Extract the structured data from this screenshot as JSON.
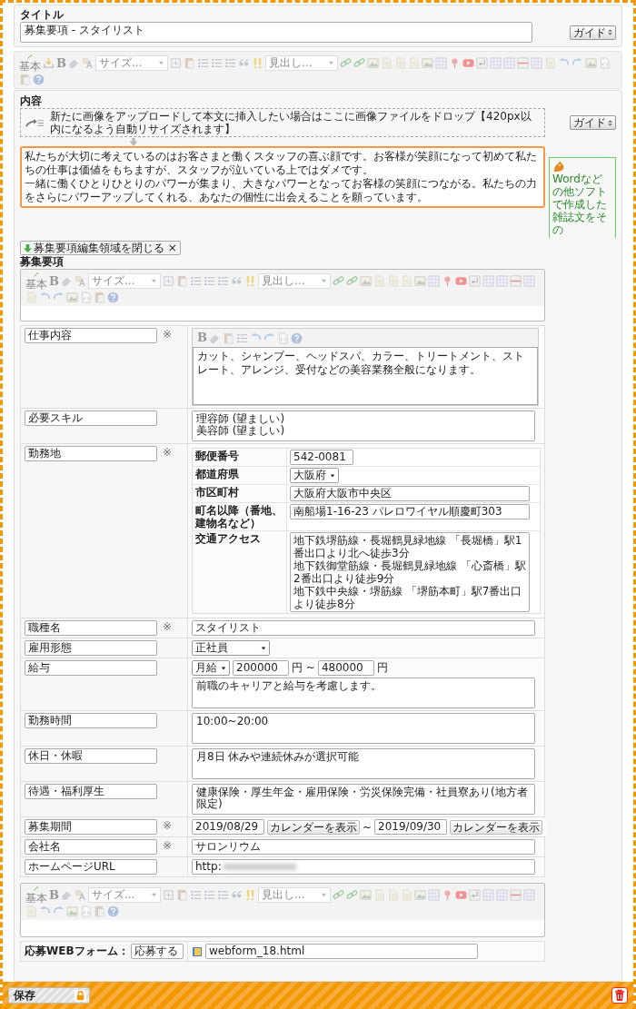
{
  "title_section": {
    "label": "タイトル",
    "value": "募集要項 - スタイリスト",
    "guide": "ガイド"
  },
  "main_toolbar": [
    {
      "kind": "basic",
      "label": "基本"
    },
    {
      "kind": "import"
    },
    {
      "kind": "bold",
      "label": "B"
    },
    {
      "kind": "eraser"
    },
    {
      "kind": "fontcolor"
    },
    {
      "kind": "select",
      "label": "サイズ..."
    },
    {
      "kind": "plus"
    },
    {
      "kind": "paste"
    },
    {
      "kind": "list"
    },
    {
      "kind": "list"
    },
    {
      "kind": "list"
    },
    {
      "kind": "quote"
    },
    {
      "kind": "exclaim"
    },
    {
      "kind": "select",
      "label": "見出し..."
    },
    {
      "kind": "link"
    },
    {
      "kind": "link"
    },
    {
      "kind": "image"
    },
    {
      "kind": "doc"
    },
    {
      "kind": "doc"
    },
    {
      "kind": "doc"
    },
    {
      "kind": "image"
    },
    {
      "kind": "table"
    },
    {
      "kind": "pin"
    },
    {
      "kind": "video"
    },
    {
      "kind": "enter"
    },
    {
      "kind": "table"
    },
    {
      "kind": "table"
    },
    {
      "kind": "hr"
    },
    {
      "kind": "table"
    },
    {
      "kind": "doc"
    },
    {
      "kind": "undo"
    },
    {
      "kind": "redo"
    },
    {
      "kind": "image"
    },
    {
      "kind": "source"
    },
    {
      "kind": "paste"
    },
    {
      "kind": "help"
    }
  ],
  "content_section": {
    "label": "内容",
    "drop_hint": "新たに画像をアップロードして本文に挿入したい場合はここに画像ファイルをドロップ【420px以内になるよう自動リサイズされます】",
    "guide": "ガイド",
    "body": [
      "私たちが大切に考えているのはお客さまと働くスタッフの喜ぶ顔です。お客様が笑顔になって初めて私たちの仕事は価値をもちますが、スタッフが泣いている上ではダメです。",
      "一緒に働くひとりひとりのパワーが集まり、大きなパワーとなってお客様の笑顔につながる。私たちの力をさらにパワーアップしてくれる、あなたの個性に出会えることを願っています。"
    ],
    "side_note": "Wordなどの他ソフトで作成した雑誌文をその",
    "close_chip": {
      "label": "募集要項編集領域を閉じる",
      "close": "×"
    }
  },
  "recruit": {
    "heading": "募集要項",
    "toolbar": [
      {
        "kind": "basic",
        "label": "基本"
      },
      {
        "kind": "bold",
        "label": "B"
      },
      {
        "kind": "eraser"
      },
      {
        "kind": "fontcolor"
      },
      {
        "kind": "select",
        "label": "サイズ..."
      },
      {
        "kind": "plus"
      },
      {
        "kind": "paste"
      },
      {
        "kind": "list"
      },
      {
        "kind": "list"
      },
      {
        "kind": "list"
      },
      {
        "kind": "quote"
      },
      {
        "kind": "exclaim"
      },
      {
        "kind": "select",
        "label": "見出し..."
      },
      {
        "kind": "link"
      },
      {
        "kind": "link"
      },
      {
        "kind": "image"
      },
      {
        "kind": "doc"
      },
      {
        "kind": "doc"
      },
      {
        "kind": "doc"
      },
      {
        "kind": "image"
      },
      {
        "kind": "table"
      },
      {
        "kind": "pin"
      },
      {
        "kind": "video"
      },
      {
        "kind": "enter"
      },
      {
        "kind": "table"
      },
      {
        "kind": "table"
      },
      {
        "kind": "hr"
      },
      {
        "kind": "table"
      },
      {
        "kind": "doc"
      },
      {
        "kind": "undo"
      },
      {
        "kind": "redo"
      },
      {
        "kind": "image"
      },
      {
        "kind": "source"
      },
      {
        "kind": "paste"
      },
      {
        "kind": "help"
      }
    ],
    "rows": [
      {
        "label": "仕事内容",
        "mark": "※",
        "kind": "rich",
        "toolbar": [
          {
            "kind": "bold",
            "label": "B"
          },
          {
            "kind": "eraser"
          },
          {
            "kind": "paste"
          },
          {
            "kind": "list"
          },
          {
            "kind": "undo"
          },
          {
            "kind": "redo"
          },
          {
            "kind": "source"
          },
          {
            "kind": "help"
          }
        ],
        "value": "カット、シャンプー、ヘッドスパ、カラー、トリートメント、ストレート、アレンジ、受付などの美容業務全般になります。"
      },
      {
        "label": "必要スキル",
        "kind": "textarea",
        "value": "理容師 (望ましい)\n美容師 (望ましい)"
      },
      {
        "label": "勤務地",
        "mark": "※",
        "kind": "address",
        "fields": [
          {
            "label": "郵便番号",
            "kind": "short",
            "value": "542-0081"
          },
          {
            "label": "都道府県",
            "kind": "select",
            "value": "大阪府"
          },
          {
            "label": "市区町村",
            "kind": "text",
            "value": "大阪府大阪市中央区"
          },
          {
            "label": "町名以降（番地、建物名など）",
            "kind": "text",
            "value": "南船場1-16-23 パレロワイヤル順慶町303"
          },
          {
            "label": "交通アクセス",
            "kind": "textarea",
            "lines": [
              "地下鉄堺筋線・長堀鶴見緑地線 「長堀橋」駅1番出口より北へ徒歩3分",
              "地下鉄御堂筋線・長堀鶴見緑地線 「心斎橋」駅2番出口より徒歩9分",
              "地下鉄中央線・堺筋線 「堺筋本町」駅7番出口より徒歩8分"
            ]
          }
        ]
      },
      {
        "label": "職種名",
        "mark": "※",
        "kind": "text",
        "value": "スタイリスト"
      },
      {
        "label": "雇用形態",
        "kind": "select",
        "value": "正社員"
      },
      {
        "label": "給与",
        "kind": "salary",
        "unit": "月給",
        "min": "200000",
        "between": "円 ~",
        "max": "480000",
        "suffix": "円",
        "note": "前職のキャリアと給与を考慮します。"
      },
      {
        "label": "勤務時間",
        "kind": "textarea",
        "value": "10:00~20:00"
      },
      {
        "label": "休日・休暇",
        "kind": "textarea",
        "value": "月8日 休みや連続休みが選択可能"
      },
      {
        "label": "待遇・福利厚生",
        "kind": "textarea",
        "value": "健康保険・厚生年金・雇用保険・労災保険完備・社員寮あり(地方者限定)"
      },
      {
        "label": "募集期間",
        "mark": "※",
        "kind": "period",
        "start": "2019/08/29",
        "calendar_start": "カレンダーを表示",
        "between": "~",
        "end": "2019/09/30",
        "calendar_end": "カレンダーを表示"
      },
      {
        "label": "会社名",
        "mark": "※",
        "kind": "text",
        "value": "サロンリウム"
      },
      {
        "label": "ホームページURL",
        "kind": "url",
        "value": "http:"
      }
    ],
    "bottom_toolbar": [
      {
        "kind": "basic",
        "label": "基本"
      },
      {
        "kind": "bold",
        "label": "B"
      },
      {
        "kind": "eraser"
      },
      {
        "kind": "fontcolor"
      },
      {
        "kind": "select",
        "label": "サイズ..."
      },
      {
        "kind": "plus"
      },
      {
        "kind": "paste"
      },
      {
        "kind": "list"
      },
      {
        "kind": "list"
      },
      {
        "kind": "list"
      },
      {
        "kind": "quote"
      },
      {
        "kind": "exclaim"
      },
      {
        "kind": "select",
        "label": "見出し..."
      },
      {
        "kind": "link"
      },
      {
        "kind": "link"
      },
      {
        "kind": "image"
      },
      {
        "kind": "doc"
      },
      {
        "kind": "doc"
      },
      {
        "kind": "doc"
      },
      {
        "kind": "image"
      },
      {
        "kind": "table"
      },
      {
        "kind": "pin"
      },
      {
        "kind": "video"
      },
      {
        "kind": "enter"
      },
      {
        "kind": "table"
      },
      {
        "kind": "table"
      },
      {
        "kind": "hr"
      },
      {
        "kind": "table"
      },
      {
        "kind": "doc"
      },
      {
        "kind": "undo"
      },
      {
        "kind": "redo"
      },
      {
        "kind": "image"
      },
      {
        "kind": "source"
      },
      {
        "kind": "paste"
      },
      {
        "kind": "help"
      }
    ],
    "webform": {
      "label": "応募WEBフォーム：",
      "button_text": "応募する",
      "file": "webform_18.html"
    }
  },
  "footer": {
    "save": "保存"
  }
}
